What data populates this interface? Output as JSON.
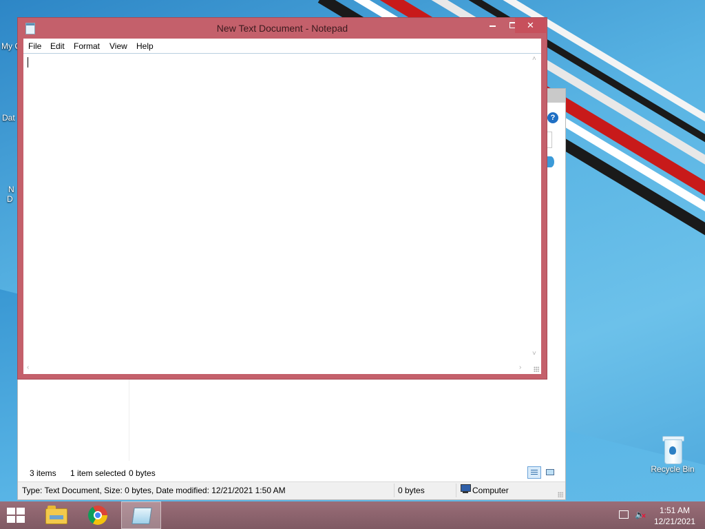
{
  "desktop": {
    "partial_labels": [
      "My C",
      "Dat",
      "N",
      "D"
    ],
    "recycle_bin_label": "Recycle Bin"
  },
  "explorer": {
    "help_glyph": "?",
    "status": {
      "item_count": "3 items",
      "selected": "1 item selected",
      "selected_size": "0 bytes"
    },
    "details_bar": {
      "info": "Type: Text Document, Size: 0 bytes, Date modified: 12/21/2021 1:50 AM",
      "size": "0 bytes",
      "location": "Computer"
    }
  },
  "notepad": {
    "title": "New Text Document - Notepad",
    "menu": [
      "File",
      "Edit",
      "Format",
      "View",
      "Help"
    ],
    "content": ""
  },
  "taskbar": {
    "apps": [
      "File Explorer",
      "Google Chrome",
      "Notepad"
    ],
    "active_app": "Notepad",
    "clock": {
      "time": "1:51 AM",
      "date": "12/21/2021"
    },
    "colors": {
      "taskbar": "#8e6670",
      "window_frame": "#c4606b",
      "close_button": "#c7505c"
    }
  }
}
